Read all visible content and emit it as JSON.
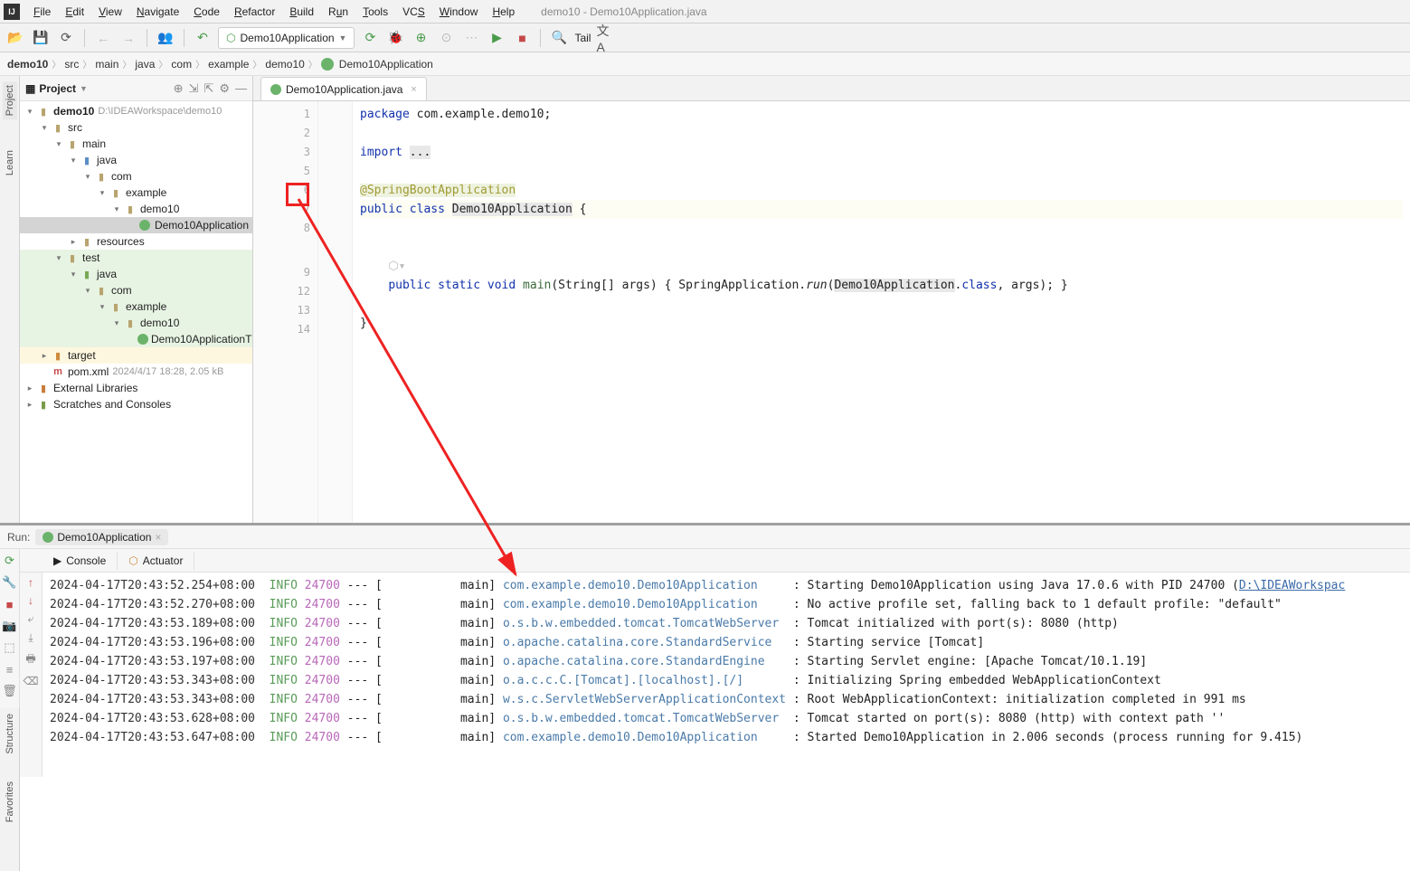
{
  "window": {
    "title": "demo10 - Demo10Application.java"
  },
  "menu": [
    "File",
    "Edit",
    "View",
    "Navigate",
    "Code",
    "Refactor",
    "Build",
    "Run",
    "Tools",
    "VCS",
    "Window",
    "Help"
  ],
  "runconfig": "Demo10Application",
  "toolbar_tail": "Tail",
  "breadcrumbs": [
    "demo10",
    "src",
    "main",
    "java",
    "com",
    "example",
    "demo10",
    "Demo10Application"
  ],
  "project_panel": {
    "title": "Project"
  },
  "tree": {
    "root": {
      "name": "demo10",
      "path": "D:\\IDEAWorkspace\\demo10"
    },
    "src": "src",
    "main": "main",
    "java": "java",
    "com": "com",
    "example": "example",
    "demo10": "demo10",
    "app_class": "Demo10Application",
    "resources": "resources",
    "test": "test",
    "java2": "java",
    "com2": "com",
    "example2": "example",
    "demo10_2": "demo10",
    "test_class": "Demo10ApplicationT",
    "target": "target",
    "pom": "pom.xml",
    "pom_meta": "2024/4/17 18:28, 2.05 kB",
    "ext_lib": "External Libraries",
    "scratch": "Scratches and Consoles"
  },
  "editor": {
    "tab": "Demo10Application.java",
    "lines": {
      "1": "package com.example.demo10;",
      "3": "import ...",
      "6": "@SpringBootApplication",
      "7": "public class Demo10Application {",
      "9": "    public static void main(String[] args) { SpringApplication.run(Demo10Application.class, args); }",
      "13": "}"
    },
    "line_numbers": [
      "1",
      "2",
      "3",
      "5",
      "6",
      "7",
      "8",
      "9",
      "12",
      "13",
      "14"
    ]
  },
  "run": {
    "label": "Run:",
    "tab": "Demo10Application",
    "console_tab": "Console",
    "actuator_tab": "Actuator",
    "log": [
      {
        "ts": "2024-04-17T20:43:52.254+08:00",
        "level": "INFO",
        "pid": "24700",
        "thread": "main",
        "logger": "com.example.demo10.Demo10Application",
        "msg": ": Starting Demo10Application using Java 17.0.6 with PID 24700 (",
        "link": "D:\\IDEAWorkspac"
      },
      {
        "ts": "2024-04-17T20:43:52.270+08:00",
        "level": "INFO",
        "pid": "24700",
        "thread": "main",
        "logger": "com.example.demo10.Demo10Application",
        "msg": ": No active profile set, falling back to 1 default profile: \"default\"",
        "link": ""
      },
      {
        "ts": "2024-04-17T20:43:53.189+08:00",
        "level": "INFO",
        "pid": "24700",
        "thread": "main",
        "logger": "o.s.b.w.embedded.tomcat.TomcatWebServer",
        "msg": ": Tomcat initialized with port(s): 8080 (http)",
        "link": ""
      },
      {
        "ts": "2024-04-17T20:43:53.196+08:00",
        "level": "INFO",
        "pid": "24700",
        "thread": "main",
        "logger": "o.apache.catalina.core.StandardService",
        "msg": ": Starting service [Tomcat]",
        "link": ""
      },
      {
        "ts": "2024-04-17T20:43:53.197+08:00",
        "level": "INFO",
        "pid": "24700",
        "thread": "main",
        "logger": "o.apache.catalina.core.StandardEngine",
        "msg": ": Starting Servlet engine: [Apache Tomcat/10.1.19]",
        "link": ""
      },
      {
        "ts": "2024-04-17T20:43:53.343+08:00",
        "level": "INFO",
        "pid": "24700",
        "thread": "main",
        "logger": "o.a.c.c.C.[Tomcat].[localhost].[/]",
        "msg": ": Initializing Spring embedded WebApplicationContext",
        "link": ""
      },
      {
        "ts": "2024-04-17T20:43:53.343+08:00",
        "level": "INFO",
        "pid": "24700",
        "thread": "main",
        "logger": "w.s.c.ServletWebServerApplicationContext",
        "msg": ": Root WebApplicationContext: initialization completed in 991 ms",
        "link": ""
      },
      {
        "ts": "2024-04-17T20:43:53.628+08:00",
        "level": "INFO",
        "pid": "24700",
        "thread": "main",
        "logger": "o.s.b.w.embedded.tomcat.TomcatWebServer",
        "msg": ": Tomcat started on port(s): 8080 (http) with context path ''",
        "link": ""
      },
      {
        "ts": "2024-04-17T20:43:53.647+08:00",
        "level": "INFO",
        "pid": "24700",
        "thread": "main",
        "logger": "com.example.demo10.Demo10Application",
        "msg": ": Started Demo10Application in 2.006 seconds (process running for 9.415)",
        "link": ""
      }
    ]
  },
  "left_tabs": {
    "project": "Project",
    "learn": "Learn"
  },
  "bottom_tabs": {
    "structure": "Structure",
    "favorites": "Favorites"
  }
}
